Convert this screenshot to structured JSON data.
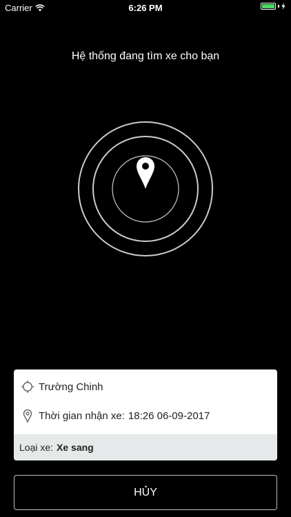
{
  "status_bar": {
    "carrier": "Carrier",
    "time": "6:26 PM",
    "battery_level": 1.0,
    "battery_color": "#4cd964"
  },
  "search": {
    "heading": "Hệ thống đang tìm xe cho bạn",
    "radar_icon": "map-pin-icon"
  },
  "trip": {
    "address_icon": "crosshair-icon",
    "address": "Trường Chinh",
    "time_icon": "location-pin-icon",
    "pickup_label": "Thời gian nhận xe:",
    "pickup_value": "18:26 06-09-2017",
    "car_type_label": "Loại xe:",
    "car_type_value": "Xe sang"
  },
  "actions": {
    "cancel_label": "HỦY"
  }
}
